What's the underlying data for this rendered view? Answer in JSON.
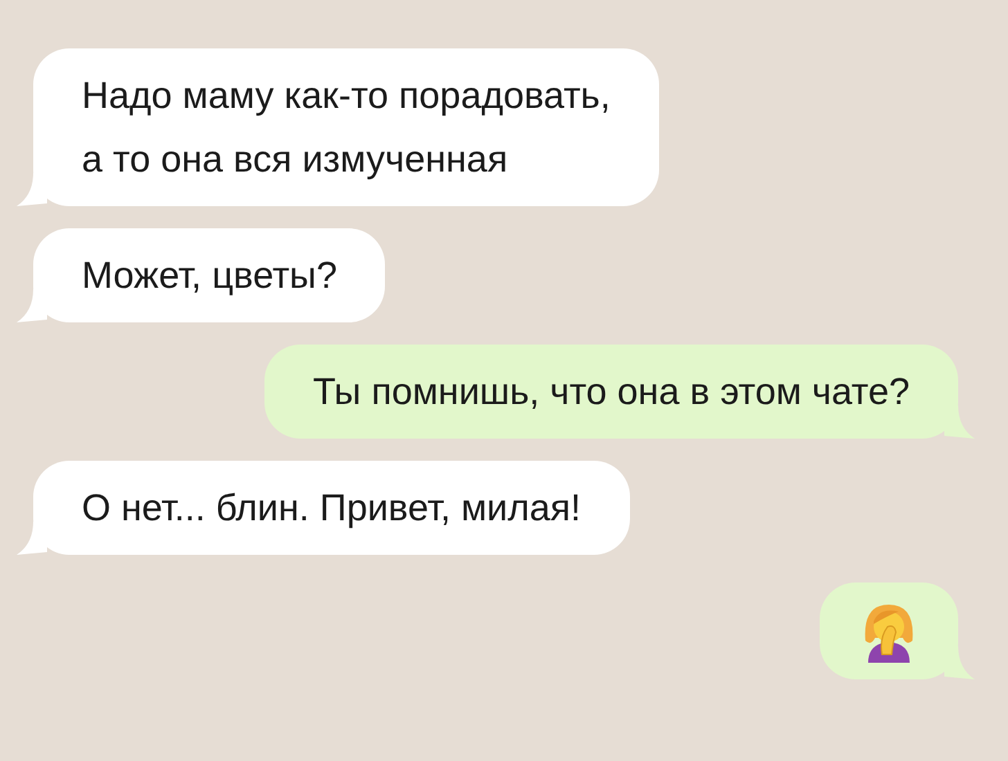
{
  "messages": [
    {
      "kind": "text",
      "sent": false,
      "lines": [
        "Надо маму как-то порадовать,",
        "а то она вся измученная"
      ]
    },
    {
      "kind": "text",
      "sent": false,
      "lines": [
        "Может, цветы?"
      ]
    },
    {
      "kind": "text",
      "sent": true,
      "lines": [
        "Ты помнишь, что она в этом чате?"
      ]
    },
    {
      "kind": "text",
      "sent": false,
      "lines": [
        "О нет... блин. Привет, милая!"
      ]
    },
    {
      "kind": "emoji",
      "sent": true
    }
  ]
}
